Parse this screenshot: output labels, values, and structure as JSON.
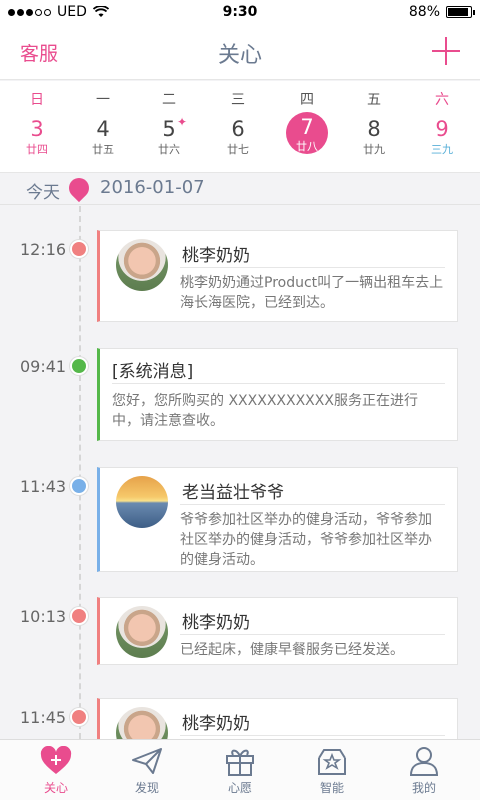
{
  "status": {
    "carrier": "UED",
    "time": "9:30",
    "battery": "88%",
    "battery_level": 0.88
  },
  "nav": {
    "left": "客服",
    "title": "关心",
    "right_icon": "plus-icon"
  },
  "week": [
    {
      "weekday": "日",
      "date": "3",
      "lunar": "廿四"
    },
    {
      "weekday": "一",
      "date": "4",
      "lunar": "廿五"
    },
    {
      "weekday": "二",
      "date": "5",
      "lunar": "廿六"
    },
    {
      "weekday": "三",
      "date": "6",
      "lunar": "廿七"
    },
    {
      "weekday": "四",
      "date": "7",
      "lunar": "廿八"
    },
    {
      "weekday": "五",
      "date": "8",
      "lunar": "廿九"
    },
    {
      "weekday": "六",
      "date": "9",
      "lunar": "三九"
    }
  ],
  "datebar": {
    "today": "今天",
    "date": "2016-01-07"
  },
  "entries": [
    {
      "time": "12:16",
      "name": "桃李奶奶",
      "text": "桃李奶奶通过Product叫了一辆出租车去上海长海医院，已经到达。"
    },
    {
      "time": "09:41",
      "name": "[系统消息]",
      "text": "您好，您所购买的 XXXXXXXXXXX服务正在进行中，请注意查收。"
    },
    {
      "time": "11:43",
      "name": "老当益壮爷爷",
      "text": "爷爷参加社区举办的健身活动，爷爷参加社区举办的健身活动，爷爷参加社区举办的健身活动。"
    },
    {
      "time": "10:13",
      "name": "桃李奶奶",
      "text": "已经起床，健康早餐服务已经发送。"
    },
    {
      "time": "11:45",
      "name": "桃李奶奶",
      "text": ""
    }
  ],
  "tabs": [
    {
      "label": "关心",
      "icon": "heart-plus-icon"
    },
    {
      "label": "发现",
      "icon": "paper-plane-icon"
    },
    {
      "label": "心愿",
      "icon": "gift-icon"
    },
    {
      "label": "智能",
      "icon": "smart-box-icon"
    },
    {
      "label": "我的",
      "icon": "user-icon"
    }
  ],
  "colors": {
    "accent": "#e94c8e",
    "red": "#f08080",
    "green": "#55b84a",
    "blue": "#79b0e8",
    "nav_text": "#6b7a90"
  }
}
